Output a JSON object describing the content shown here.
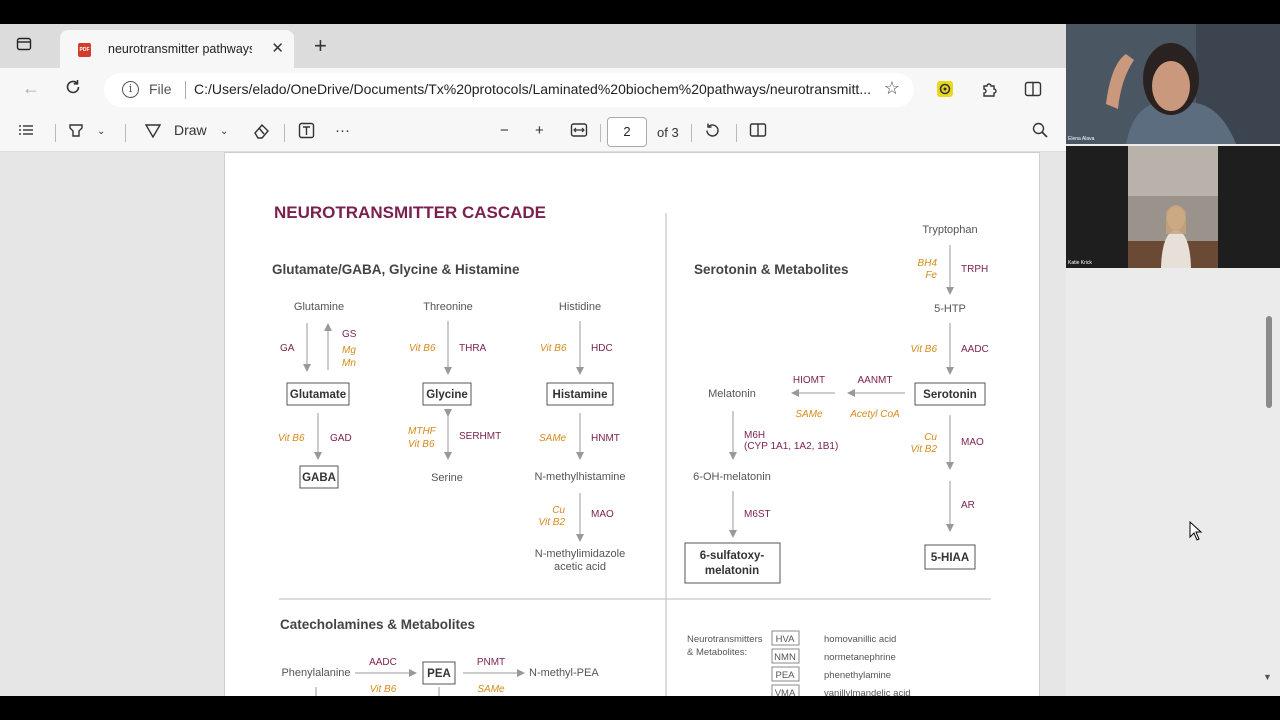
{
  "browser": {
    "tab_title": "neurotransmitter pathways",
    "favicon_label": "PDF",
    "address_scheme": "File",
    "url": "C:/Users/elado/OneDrive/Documents/Tx%20protocols/Laminated%20biochem%20pathways/neurotransmitt...",
    "icons": [
      "tab-actions-icon",
      "close-icon",
      "plus-icon",
      "back-icon",
      "refresh-icon",
      "info-icon",
      "star-icon",
      "extension-icon",
      "puzzle-icon",
      "split-screen-icon"
    ]
  },
  "pdf_toolbar": {
    "draw_label": "Draw",
    "page_current": "2",
    "page_total": "of 3",
    "icons": [
      "contents-icon",
      "highlight-icon",
      "draw-icon",
      "eraser-icon",
      "text-icon",
      "more-icon",
      "zoom-out-icon",
      "zoom-in-icon",
      "fit-width-icon",
      "rotate-icon",
      "page-view-icon",
      "search-icon"
    ]
  },
  "video": {
    "participant1": "Elena Alava",
    "participant2": "Katie Krick"
  },
  "doc": {
    "title": "NEUROTRANSMITTER CASCADE",
    "section1": "Glutamate/GABA, Glycine & Histamine",
    "section2": "Serotonin & Metabolites",
    "section3": "Catecholamines & Metabolites",
    "glut": {
      "top": "Glutamine",
      "ga": "GA",
      "gs": "GS",
      "mg": "Mg",
      "mn": "Mn",
      "box": "Glutamate",
      "vb6": "Vit B6",
      "gad": "GAD",
      "bottom": "GABA"
    },
    "gly": {
      "top": "Threonine",
      "vb6": "Vit B6",
      "thra": "THRA",
      "box": "Glycine",
      "mthf": "MTHF",
      "vb6b": "Vit B6",
      "serhmt": "SERHMT",
      "bottom": "Serine"
    },
    "his": {
      "top": "Histidine",
      "vb6": "Vit B6",
      "hdc": "HDC",
      "box": "Histamine",
      "same": "SAMe",
      "hnmt": "HNMT",
      "mid": "N-methylhistamine",
      "cu": "Cu",
      "vb2": "Vit B2",
      "mao": "MAO",
      "bottom1": "N-methylimidazole",
      "bottom2": "acetic acid"
    },
    "ser": {
      "trp": "Tryptophan",
      "bh4": "BH4",
      "fe": "Fe",
      "trph": "TRPH",
      "htp": "5-HTP",
      "vb6": "Vit B6",
      "aadc": "AADC",
      "box": "Serotonin",
      "aanmt": "AANMT",
      "acetyl": "Acetyl CoA",
      "hiomt": "HIOMT",
      "same": "SAMe",
      "mel": "Melatonin",
      "m6h": "M6H",
      "cyp": "(CYP 1A1, 1A2, 1B1)",
      "ohmel": "6-OH-melatonin",
      "m6st": "M6ST",
      "sulf1": "6-sulfatoxy-",
      "sulf2": "melatonin",
      "cu": "Cu",
      "vb2": "Vit B2",
      "mao": "MAO",
      "ar": "AR",
      "hiaa": "5-HIAA"
    },
    "cat": {
      "phe": "Phenylalanine",
      "aadc": "AADC",
      "vb6": "Vit B6",
      "pea": "PEA",
      "pnmt": "PNMT",
      "same": "SAMe",
      "npea": "N-methyl-PEA"
    },
    "legend": {
      "label1": "Neurotransmitters",
      "label2": "& Metabolites:",
      "items": [
        {
          "abbr": "HVA",
          "name": "homovanillic acid"
        },
        {
          "abbr": "NMN",
          "name": "normetanephrine"
        },
        {
          "abbr": "PEA",
          "name": "phenethylamine"
        },
        {
          "abbr": "VMA",
          "name": "vanillylmandelic acid"
        }
      ]
    }
  },
  "colors": {
    "title": "#7b1f4e",
    "enzyme": "#7b1f4e",
    "cofactor": "#d68a1a",
    "text": "#555555",
    "arrow": "#999999"
  }
}
